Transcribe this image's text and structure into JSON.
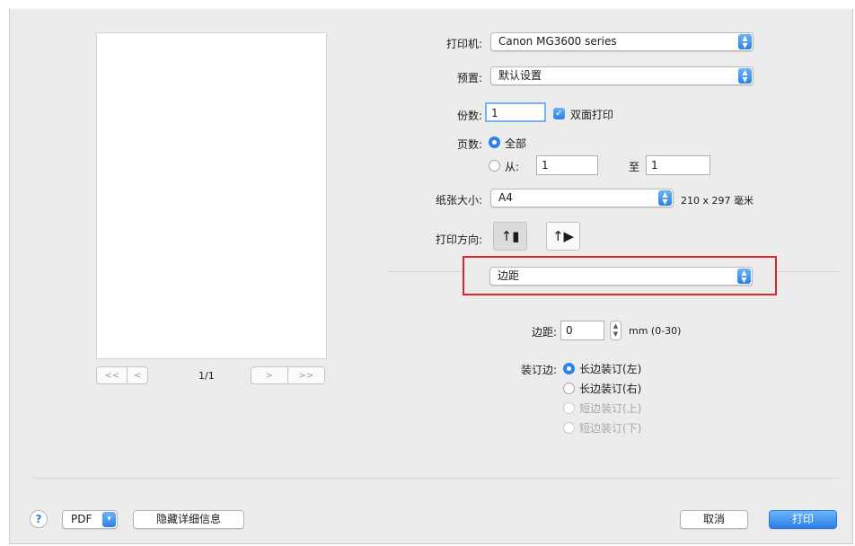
{
  "printer": {
    "label": "打印机:",
    "value": "Canon MG3600 series"
  },
  "presets": {
    "label": "预置:",
    "value": "默认设置"
  },
  "copies": {
    "label": "份数:",
    "value": "1",
    "duplex_label": "双面打印",
    "duplex_checked": true
  },
  "pages": {
    "label": "页数:",
    "all_label": "全部",
    "from_label": "从:",
    "from_value": "1",
    "to_label": "至",
    "to_value": "1"
  },
  "paper_size": {
    "label": "纸张大小:",
    "value": "A4",
    "dimensions": "210 x 297 毫米"
  },
  "orientation": {
    "label": "打印方向:",
    "portrait_icon": "portrait-orientation-icon",
    "landscape_icon": "landscape-orientation-icon"
  },
  "panel_select": {
    "value": "边距"
  },
  "margin": {
    "label": "边距:",
    "value": "0",
    "unit": "mm (0-30)"
  },
  "binding": {
    "label": "装订边:",
    "options": [
      {
        "label": "长边装订(左)",
        "selected": true,
        "enabled": true
      },
      {
        "label": "长边装订(右)",
        "selected": false,
        "enabled": true
      },
      {
        "label": "短边装订(上)",
        "selected": false,
        "enabled": false
      },
      {
        "label": "短边装订(下)",
        "selected": false,
        "enabled": false
      }
    ]
  },
  "preview": {
    "page_indicator": "1/1",
    "nav": {
      "first": "<<",
      "prev": "<",
      "next": ">",
      "last": ">>"
    }
  },
  "footer": {
    "help": "?",
    "pdf_label": "PDF",
    "hide_details_label": "隐藏详细信息",
    "cancel_label": "取消",
    "print_label": "打印"
  },
  "colors": {
    "accent": "#2a7fe7",
    "highlight": "#e0242a"
  }
}
